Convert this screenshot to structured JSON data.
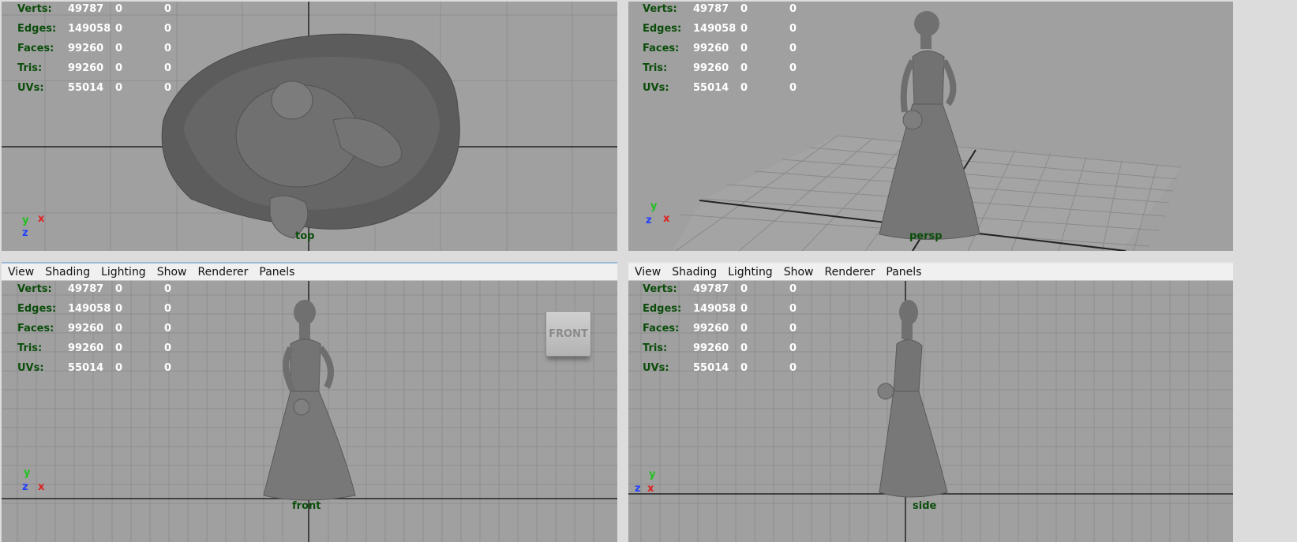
{
  "stats_labels": [
    "Verts:",
    "Edges:",
    "Faces:",
    "Tris:",
    "UVs:"
  ],
  "stats_values": [
    [
      "49787",
      "0",
      "0"
    ],
    [
      "149058",
      "0",
      "0"
    ],
    [
      "99260",
      "0",
      "0"
    ],
    [
      "99260",
      "0",
      "0"
    ],
    [
      "55014",
      "0",
      "0"
    ]
  ],
  "menu": [
    "View",
    "Shading",
    "Lighting",
    "Show",
    "Renderer",
    "Panels"
  ],
  "viewports": {
    "top": {
      "label": "top",
      "axes": [
        "y",
        "x",
        "z"
      ]
    },
    "persp": {
      "label": "persp",
      "axes": [
        "y",
        "z",
        "x"
      ]
    },
    "front": {
      "label": "front",
      "axes": [
        "y",
        "z",
        "x"
      ],
      "viewcube": "FRONT"
    },
    "side": {
      "label": "side",
      "axes": [
        "y",
        "z",
        "x"
      ]
    }
  },
  "colors": {
    "viewport_bg": "#a0a0a0",
    "grid": "#8e8e8e",
    "hud_label": "#0b4d0b",
    "hud_value": "#ffffff",
    "model": "#6a6a6a"
  }
}
